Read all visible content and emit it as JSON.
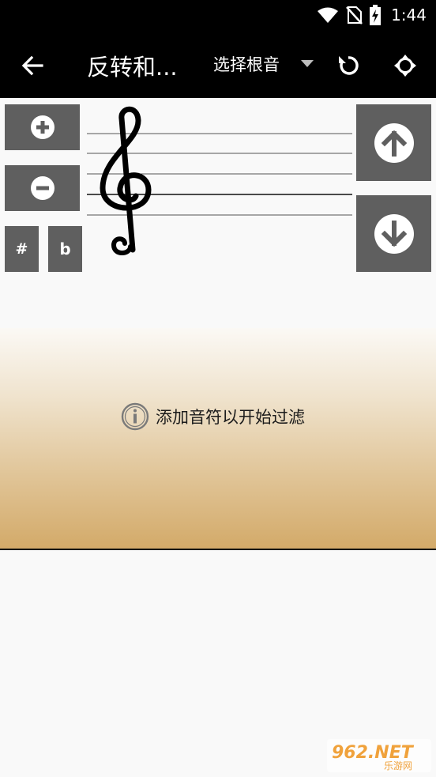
{
  "status_bar": {
    "time": "1:44"
  },
  "app_bar": {
    "title": "反转和...",
    "root_select_label": "选择根音"
  },
  "controls": {
    "sharp_label": "#",
    "flat_label": "b"
  },
  "filter_panel": {
    "message": "添加音符以开始过滤"
  },
  "watermark": {
    "brand": "962.NET",
    "subtitle": "乐游网"
  },
  "colors": {
    "app_bar_bg": "#000000",
    "button_bg": "#5f5f5f",
    "gradient_top": "#fbf9f5",
    "gradient_bottom": "#d3aa69",
    "watermark_accent": "#f0a23c"
  }
}
